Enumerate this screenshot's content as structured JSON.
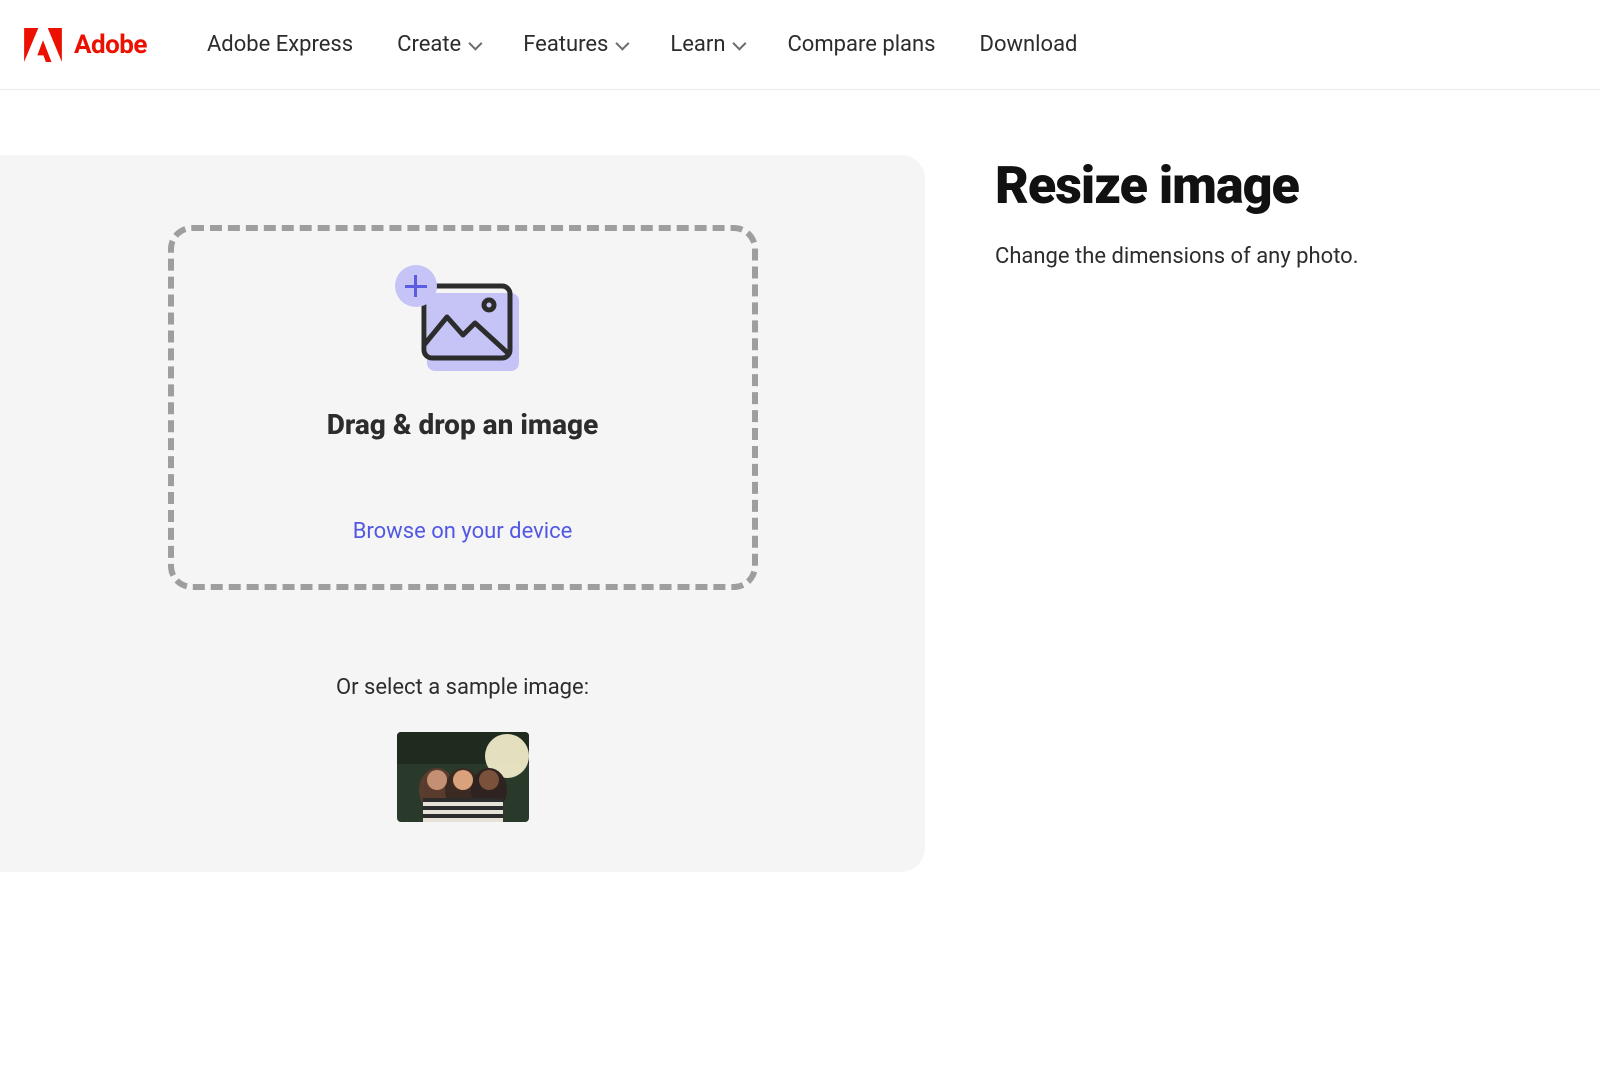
{
  "header": {
    "brand": "Adobe",
    "nav_items": [
      {
        "label": "Adobe Express",
        "dropdown": false
      },
      {
        "label": "Create",
        "dropdown": true
      },
      {
        "label": "Features",
        "dropdown": true
      },
      {
        "label": "Learn",
        "dropdown": true
      },
      {
        "label": "Compare plans",
        "dropdown": false
      },
      {
        "label": "Download",
        "dropdown": false
      }
    ]
  },
  "dropzone": {
    "headline": "Drag & drop an image",
    "browse_label": "Browse on your device"
  },
  "sample": {
    "label": "Or select a sample image:"
  },
  "sidebar": {
    "title": "Resize image",
    "subtitle": "Change the dimensions of any photo."
  }
}
